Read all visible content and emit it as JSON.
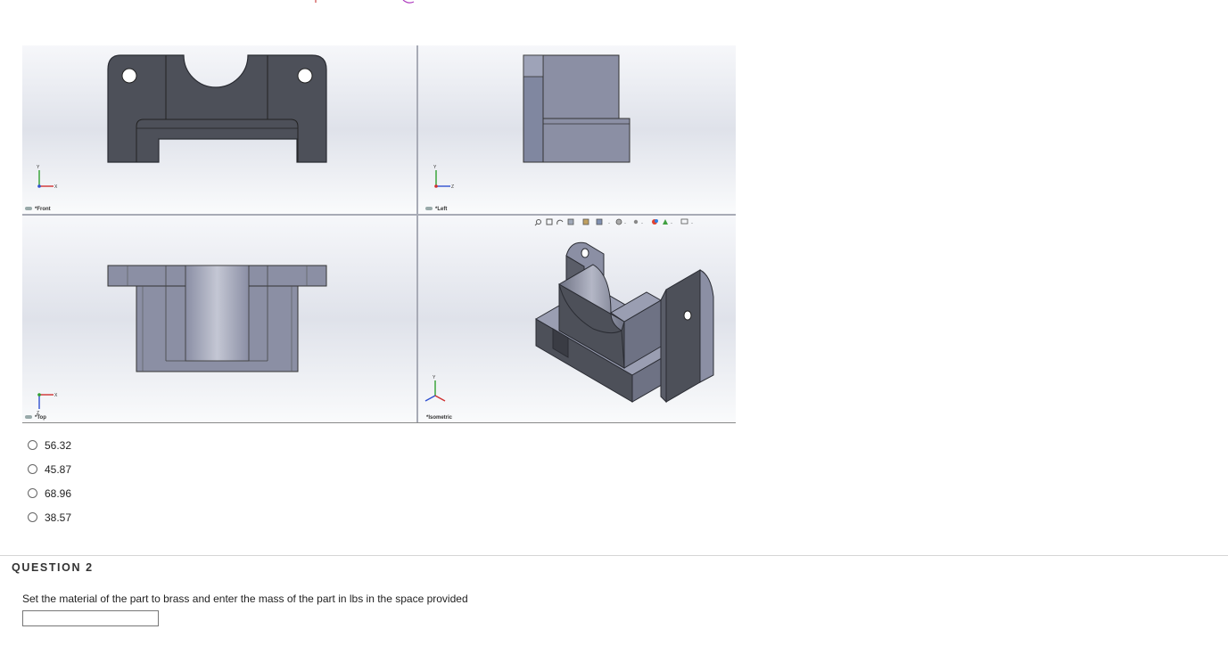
{
  "question1": {
    "figure": {
      "views": {
        "front": "*Front",
        "left": "*Left",
        "top": "*Top",
        "isometric": "*Isometric"
      },
      "toolbar_icons": [
        "zoom-icon",
        "zoom-area-icon",
        "rotate-icon",
        "section-view-icon",
        "view-orientation-icon",
        "display-style-icon",
        "hide-show-icon",
        "appearance-icon",
        "scene-icon",
        "monitor-icon"
      ]
    },
    "options": [
      {
        "label": "56.32"
      },
      {
        "label": "45.87"
      },
      {
        "label": "68.96"
      },
      {
        "label": "38.57"
      }
    ]
  },
  "question2": {
    "title": "QUESTION 2",
    "prompt": "Set the material of the part to brass and enter the mass of the part in lbs in the space provided",
    "answer_value": ""
  }
}
